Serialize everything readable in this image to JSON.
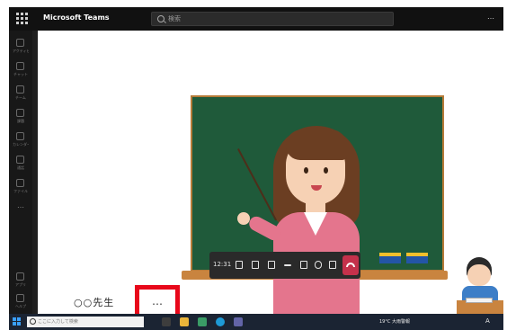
{
  "window": {
    "app_title": "Microsoft Teams"
  },
  "search": {
    "placeholder": "検索"
  },
  "header": {
    "more_label": "…"
  },
  "rail": {
    "items": [
      {
        "label": "アクティビティ",
        "icon": "bell-icon"
      },
      {
        "label": "チャット",
        "icon": "chat-icon"
      },
      {
        "label": "チーム",
        "icon": "teams-icon"
      },
      {
        "label": "課題",
        "icon": "assignments-icon"
      },
      {
        "label": "カレンダー",
        "icon": "calendar-icon"
      },
      {
        "label": "通話",
        "icon": "phone-icon"
      },
      {
        "label": "ファイル",
        "icon": "files-icon"
      }
    ],
    "more": "…",
    "bottom_items": [
      {
        "label": "アプリ",
        "icon": "apps-icon"
      },
      {
        "label": "ヘルプ",
        "icon": "help-icon"
      }
    ]
  },
  "meeting": {
    "timer": "12:31",
    "controls": [
      {
        "name": "participants-button",
        "icon": "people-icon"
      },
      {
        "name": "chat-button",
        "icon": "chat-icon"
      },
      {
        "name": "reactions-button",
        "icon": "hand-icon"
      },
      {
        "name": "more-actions-button",
        "icon": "more-icon"
      },
      {
        "name": "camera-button",
        "icon": "camera-icon"
      },
      {
        "name": "mic-button",
        "icon": "mic-icon"
      },
      {
        "name": "share-button",
        "icon": "share-icon"
      }
    ],
    "leave_color": "#c4314b"
  },
  "participant": {
    "name": "○○先生",
    "more_label": "…"
  },
  "taskbar": {
    "search_placeholder": "ここに入力して検索",
    "weather": "19°C 大雨警報",
    "ime": "A"
  },
  "colors": {
    "highlight": "#e8081a",
    "chalkboard": "#1f5a3a"
  }
}
